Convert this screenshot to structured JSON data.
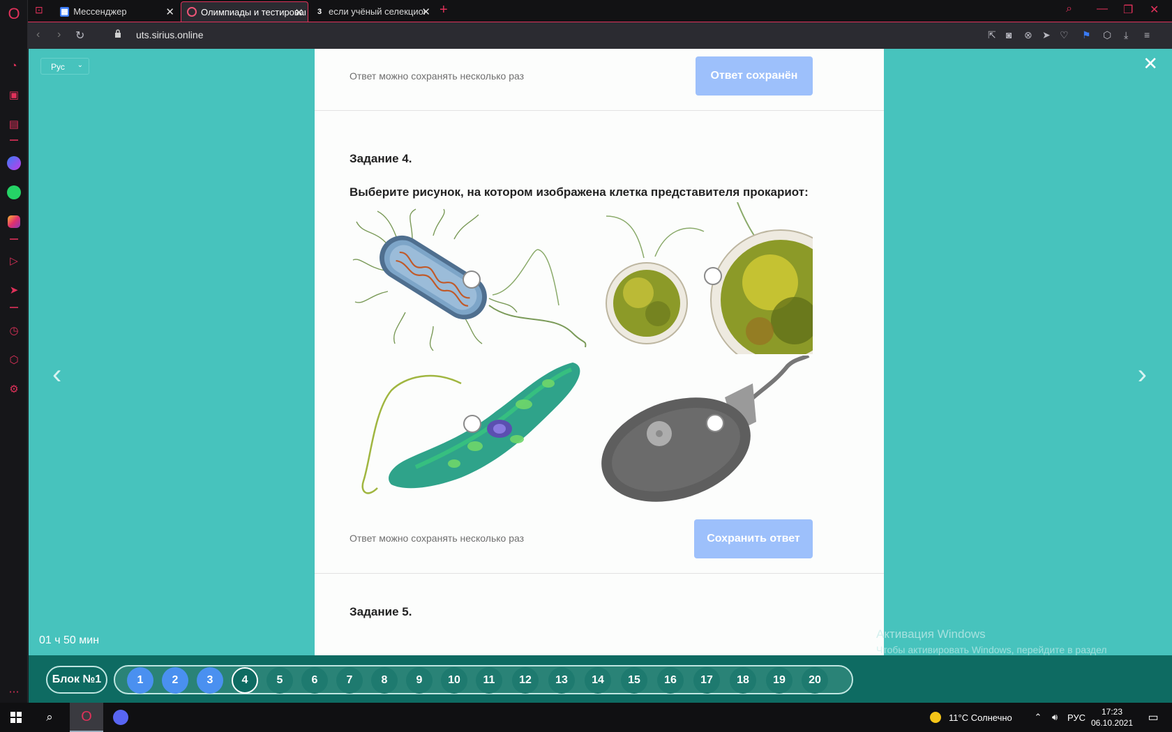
{
  "browser": {
    "tabs": [
      {
        "title": "Мессенджер"
      },
      {
        "title": "Олимпиады и тестирования"
      },
      {
        "title": "если учёный селекционер"
      }
    ],
    "url": "uts.sirius.online"
  },
  "page": {
    "language": "Рус",
    "timer": "01 ч 50 мин",
    "prev_task": {
      "note": "Ответ можно сохранять несколько раз",
      "button": "Ответ сохранён"
    },
    "task4": {
      "title": "Задание 4.",
      "question": "Выберите рисунок, на котором изображена клетка представителя прокариот:",
      "options": [
        {
          "id": "bacterium"
        },
        {
          "id": "chlorella"
        },
        {
          "id": "euglena"
        },
        {
          "id": "paramecium-like"
        }
      ],
      "note": "Ответ можно сохранять несколько раз",
      "button": "Сохранить ответ"
    },
    "next_task_title": "Задание 5."
  },
  "activation": {
    "title": "Активация Windows",
    "text": "Чтобы активировать Windows, перейдите в раздел \"Параметры\"."
  },
  "navigator": {
    "block_label": "Блок №1",
    "items": [
      {
        "n": "1",
        "state": "done"
      },
      {
        "n": "2",
        "state": "done"
      },
      {
        "n": "3",
        "state": "done"
      },
      {
        "n": "4",
        "state": "current"
      },
      {
        "n": "5",
        "state": "todo"
      },
      {
        "n": "6",
        "state": "todo"
      },
      {
        "n": "7",
        "state": "todo"
      },
      {
        "n": "8",
        "state": "todo"
      },
      {
        "n": "9",
        "state": "todo"
      },
      {
        "n": "10",
        "state": "todo"
      },
      {
        "n": "11",
        "state": "todo"
      },
      {
        "n": "12",
        "state": "todo"
      },
      {
        "n": "13",
        "state": "todo"
      },
      {
        "n": "14",
        "state": "todo"
      },
      {
        "n": "15",
        "state": "todo"
      },
      {
        "n": "16",
        "state": "todo"
      },
      {
        "n": "17",
        "state": "todo"
      },
      {
        "n": "18",
        "state": "todo"
      },
      {
        "n": "19",
        "state": "todo"
      },
      {
        "n": "20",
        "state": "todo"
      }
    ]
  },
  "os_taskbar": {
    "weather": "11°C  Солнечно",
    "lang": "РУС",
    "time": "17:23",
    "date": "06.10.2021"
  },
  "colors": {
    "page_bg": "#47c3bd",
    "accent": "#e0315a",
    "button": "#9dc0fb",
    "done_number": "#4a90f0",
    "nav_bg": "#0e6b62"
  }
}
